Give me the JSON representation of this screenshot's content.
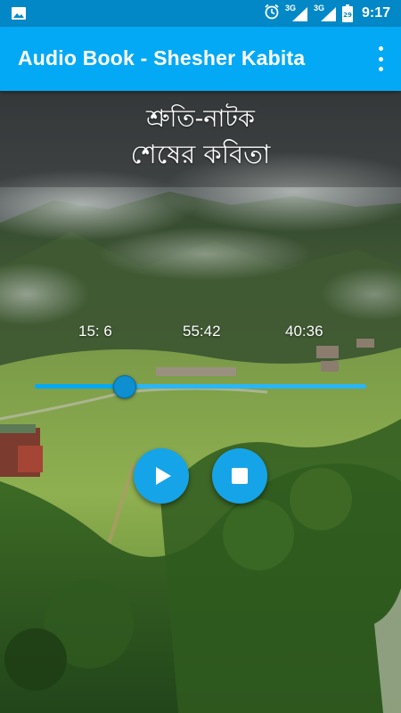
{
  "status_bar": {
    "time": "9:17",
    "network_1": "3G",
    "network_2": "3G",
    "battery_level": "29",
    "icons": [
      "image-icon",
      "alarm-icon",
      "signal-icon",
      "signal-icon",
      "battery-icon"
    ]
  },
  "app_bar": {
    "title": "Audio Book - Shesher Kabita",
    "menu_icon": "overflow-menu-icon"
  },
  "content": {
    "heading_line1": "শ্রুতি-নাটক",
    "heading_line2": "শেষের কবিতা"
  },
  "player": {
    "current_time": "15: 6",
    "total_time": "55:42",
    "remaining_time": "40:36",
    "progress": 0.27,
    "play_icon": "play-icon",
    "stop_icon": "stop-icon"
  },
  "colors": {
    "status_bar": "#0288c7",
    "app_bar": "#03a9f4",
    "accent": "#16a4e8"
  }
}
